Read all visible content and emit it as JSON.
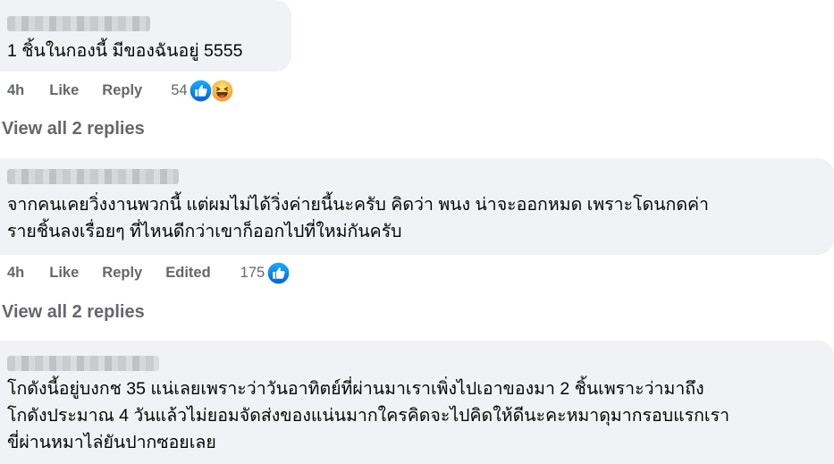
{
  "comments": [
    {
      "text_lines": [
        "1 ชิ้นในกองนี้ มีของฉันอยู่ 5555"
      ],
      "time": "4h",
      "like_label": "Like",
      "reply_label": "Reply",
      "edited_label": "",
      "reaction_count": "54",
      "reactions": [
        "like-icon",
        "haha-icon"
      ],
      "view_replies": "View all 2 replies"
    },
    {
      "text_lines": [
        "จากคนเคยวิ่งงานพวกนี้ แต่ผมไม่ได้วิ่งค่ายนี้นะครับ คิดว่า พนง น่าจะออกหมด เพราะโดนกดค่า",
        "รายชิ้นลงเรื่อยๆ ที่ไหนดีกว่าเขาก็ออกไปที่ใหม่กันครับ"
      ],
      "time": "4h",
      "like_label": "Like",
      "reply_label": "Reply",
      "edited_label": "Edited",
      "reaction_count": "175",
      "reactions": [
        "like-icon"
      ],
      "view_replies": "View all 2 replies"
    },
    {
      "text_lines": [
        "โกดังนี้อยู่บงกช 35 แน่เลยเพราะว่าวันอาทิตย์ที่ผ่านมาเราเพิ่งไปเอาของมา 2 ชิ้นเพราะว่ามาถึง",
        "โกดังประมาณ 4 วันแล้วไม่ยอมจัดส่งของแน่นมากใครคิดจะไปคิดให้ดีนะคะหมาดุมากรอบแรกเรา",
        "ขี่ผ่านหมาไล่ยันปากซอยเลย"
      ]
    }
  ],
  "colors": {
    "bubble": "#f0f2f5",
    "text": "#050505",
    "meta": "#65676b",
    "like_blue": "#1877f2",
    "haha_yellow": "#f7b125"
  }
}
